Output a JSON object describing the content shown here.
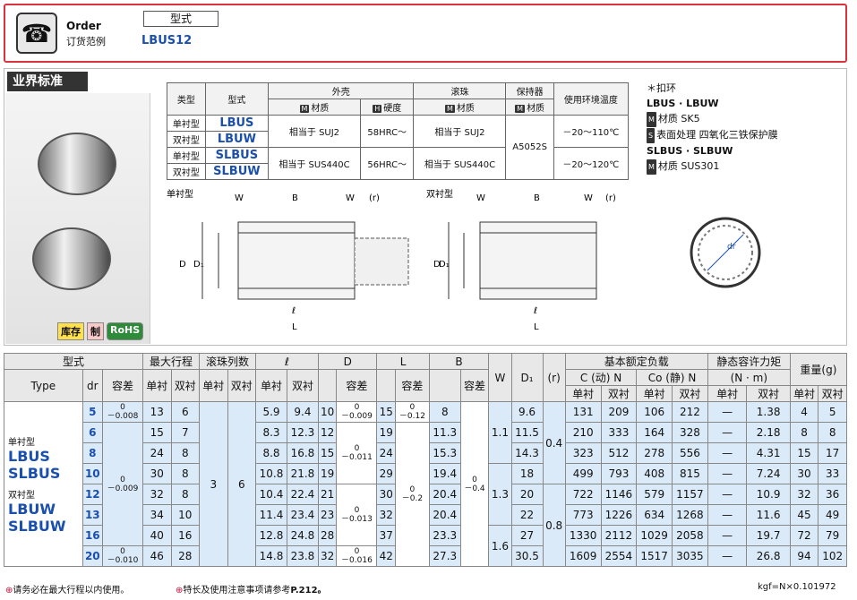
{
  "order": {
    "label_en": "Order",
    "label_zh": "订货范例",
    "type_header": "型式",
    "example": "LBUS12"
  },
  "standard": {
    "title": "业界标准",
    "badges": [
      "库存",
      "制",
      "RoHS"
    ]
  },
  "materials": {
    "headers": {
      "type": "类型",
      "model": "型式",
      "shell": "外壳",
      "ball": "滚珠",
      "retainer": "保持器",
      "env": "使用环境温度",
      "mat": "材质",
      "hard": "硬度"
    },
    "rows": [
      {
        "type": "单衬型",
        "model": "LBUS"
      },
      {
        "type": "双衬型",
        "model": "LBUW"
      },
      {
        "type": "单衬型",
        "model": "SLBUS"
      },
      {
        "type": "双衬型",
        "model": "SLBUW"
      }
    ],
    "shell_mat_1": "相当于 SUJ2",
    "shell_hard_1": "58HRC～",
    "ball_1": "相当于 SUJ2",
    "retainer": "A5052S",
    "env_1": "－20～110℃",
    "shell_mat_2": "相当于 SUS440C",
    "shell_hard_2": "56HRC～",
    "ball_2": "相当于 SUS440C",
    "env_2": "－20～120℃"
  },
  "notes": {
    "title": "＊扣环",
    "g1": "LBUS · LBUW",
    "g1_mat": "材质 SK5",
    "g1_surf": "表面处理 四氧化三铁保护膜",
    "g2": "SLBUS · SLBUW",
    "g2_mat": "材质 SUS301"
  },
  "drawing": {
    "single": "单衬型",
    "double": "双衬型",
    "W": "W",
    "B": "B",
    "r": "(r)",
    "D": "D",
    "D1": "D₁",
    "l": "ℓ",
    "L": "L",
    "dr": "dr"
  },
  "table": {
    "h1": {
      "type": "型式",
      "stroke": "最大行程",
      "rows": "滚珠列数",
      "l": "ℓ",
      "D": "D",
      "L": "L",
      "B": "B",
      "W": "W",
      "D1": "D₁",
      "r": "(r)",
      "load": "基本额定负载",
      "moment": "静态容许力矩",
      "momentunit": "(N · m)",
      "weight": "重量(g)"
    },
    "h2": {
      "Type": "Type",
      "dr": "dr",
      "tol": "容差",
      "single": "单衬",
      "double": "双衬",
      "C": "C (动) N",
      "Co": "Co (静) N"
    },
    "group1": "单衬型",
    "group1a": "LBUS",
    "group1b": "SLBUS",
    "group2": "双衬型",
    "group2a": "LBUW",
    "group2b": "SLBUW",
    "dr_tol": [
      "0 －0.008",
      "0 －0.009",
      "0 －0.010"
    ],
    "D_tol": [
      "0 －0.009",
      "0 －0.011",
      "0 －0.013",
      "0 －0.016"
    ],
    "L_tol": [
      "0 －0.12",
      "0 －0.2"
    ],
    "B_tol": "0 －0.4",
    "rows": [
      [
        "5",
        "13",
        "6",
        "5.9",
        "9.4",
        "10",
        "15",
        "8",
        "9.6",
        "131",
        "209",
        "106",
        "212",
        "—",
        "1.38",
        "4",
        "5"
      ],
      [
        "6",
        "15",
        "7",
        "8.3",
        "12.3",
        "12",
        "19",
        "11.3",
        "11.5",
        "210",
        "333",
        "164",
        "328",
        "—",
        "2.18",
        "8",
        "8"
      ],
      [
        "8",
        "24",
        "8",
        "8.8",
        "16.8",
        "15",
        "24",
        "15.3",
        "14.3",
        "323",
        "512",
        "278",
        "556",
        "—",
        "4.31",
        "15",
        "17"
      ],
      [
        "10",
        "30",
        "8",
        "10.8",
        "21.8",
        "19",
        "29",
        "19.4",
        "18",
        "499",
        "793",
        "408",
        "815",
        "—",
        "7.24",
        "30",
        "33"
      ],
      [
        "12",
        "32",
        "8",
        "10.4",
        "22.4",
        "21",
        "30",
        "20.4",
        "20",
        "722",
        "1146",
        "579",
        "1157",
        "—",
        "10.9",
        "32",
        "36"
      ],
      [
        "13",
        "34",
        "10",
        "11.4",
        "23.4",
        "23",
        "32",
        "20.4",
        "22",
        "773",
        "1226",
        "634",
        "1268",
        "—",
        "11.6",
        "45",
        "49"
      ],
      [
        "16",
        "40",
        "16",
        "12.8",
        "24.8",
        "28",
        "37",
        "23.3",
        "27",
        "1330",
        "2112",
        "1029",
        "2058",
        "—",
        "19.7",
        "72",
        "79"
      ],
      [
        "20",
        "46",
        "28",
        "14.8",
        "23.8",
        "32",
        "42",
        "27.3",
        "30.5",
        "1609",
        "2554",
        "1517",
        "3035",
        "—",
        "26.8",
        "94",
        "102"
      ]
    ],
    "balls_single": "3",
    "balls_double": "6",
    "W_vals": [
      "1.1",
      "1.3",
      "1.6"
    ],
    "r_vals": [
      "0.4",
      "0.8"
    ]
  },
  "footer": {
    "note1": "请务必在最大行程以内使用。",
    "note2": "特长及使用注意事项请参考",
    "ref": "P.212。",
    "unit": "kgf=N×0.101972"
  }
}
